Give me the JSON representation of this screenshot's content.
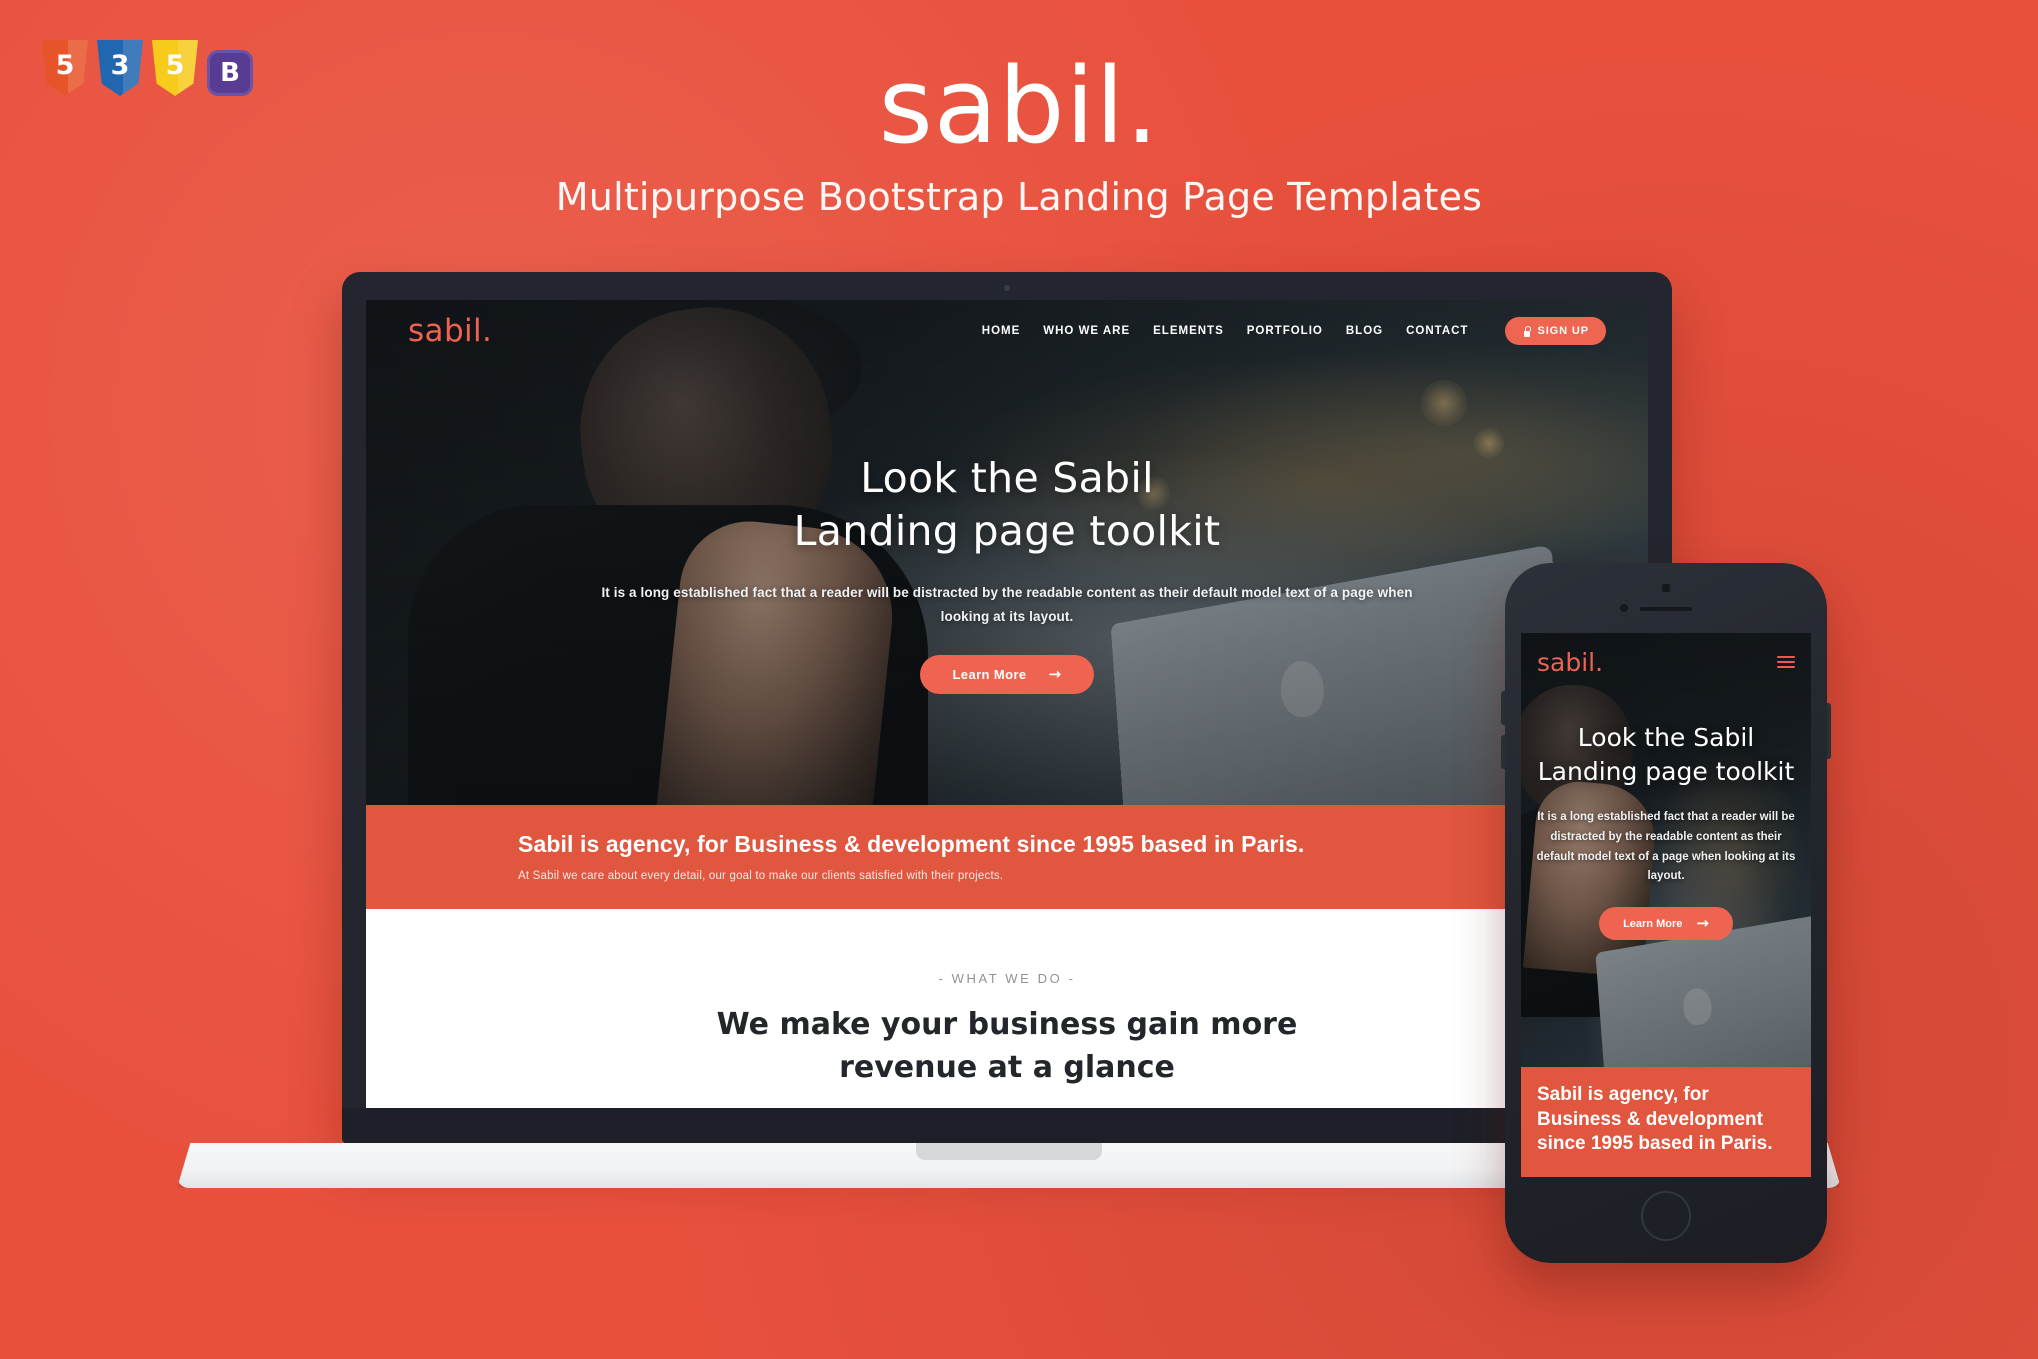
{
  "page": {
    "background_color": "#e8503c",
    "accent_color": "#ef6351",
    "band_color": "#e0563f",
    "dark_frame_color": "#23262e"
  },
  "badges": [
    {
      "name": "html5-badge",
      "glyph": "5",
      "color": "#e8542a"
    },
    {
      "name": "css3-badge",
      "glyph": "3",
      "color": "#2167b0"
    },
    {
      "name": "js-badge",
      "glyph": "5",
      "color": "#f6cb1c"
    },
    {
      "name": "bootstrap-badge",
      "glyph": "B",
      "color": "#583c94"
    }
  ],
  "header": {
    "wordmark": "sabil.",
    "tagline": "Multipurpose Bootstrap Landing Page Templates"
  },
  "desktop_site": {
    "logo": "sabil.",
    "nav_items": [
      {
        "label": "HOME"
      },
      {
        "label": "WHO WE ARE"
      },
      {
        "label": "ELEMENTS"
      },
      {
        "label": "PORTFOLIO"
      },
      {
        "label": "BLOG"
      },
      {
        "label": "CONTACT"
      }
    ],
    "signup_label": "SIGN UP",
    "signup_icon": "lock-icon",
    "hero_title_line1": "Look the Sabil",
    "hero_title_line2": "Landing page toolkit",
    "hero_paragraph": "It is a long established fact that a reader will be distracted by the readable content as their default model text of a page when looking at its layout.",
    "cta_label": "Learn More",
    "cta_icon": "arrow-right-icon",
    "band_title": "Sabil is agency, for Business & development since 1995 based in Paris.",
    "band_subtitle": "At Sabil we care about every detail, our goal to make our clients satisfied with their projects.",
    "what_eyebrow": "- WHAT WE DO -",
    "what_heading_line1": "We make your business gain more",
    "what_heading_line2": "revenue at a glance"
  },
  "mobile_site": {
    "logo": "sabil.",
    "menu_icon": "hamburger-menu-icon",
    "hero_title_line1": "Look the Sabil",
    "hero_title_line2": "Landing page toolkit",
    "hero_paragraph": "It is a long established fact that a reader will be distracted by the readable content as their default model text of a page when looking at its layout.",
    "cta_label": "Learn More",
    "cta_icon": "arrow-right-icon",
    "band_title": "Sabil is agency, for Business & development since 1995 based in Paris."
  },
  "icons": {
    "arrow_right": "→"
  }
}
